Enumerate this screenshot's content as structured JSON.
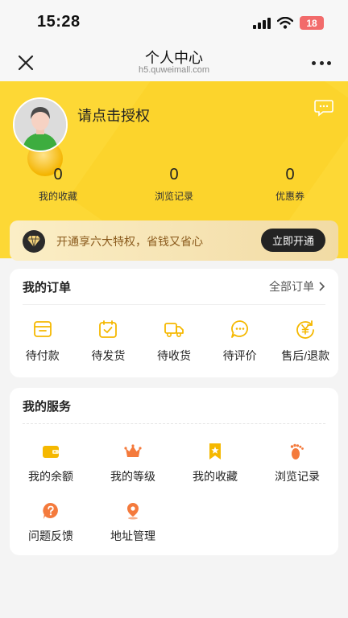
{
  "status_bar": {
    "time": "15:28",
    "battery": "18"
  },
  "nav": {
    "title": "个人中心",
    "subtitle": "h5.quweimall.com"
  },
  "profile": {
    "login_prompt": "请点击授权"
  },
  "stats": [
    {
      "value": "0",
      "label": "我的收藏"
    },
    {
      "value": "0",
      "label": "浏览记录"
    },
    {
      "value": "0",
      "label": "优惠券"
    }
  ],
  "vip": {
    "text": "开通享六大特权，省钱又省心",
    "button": "立即开通"
  },
  "orders": {
    "title": "我的订单",
    "all_label": "全部订单",
    "items": [
      {
        "label": "待付款",
        "icon": "wallet-card-icon"
      },
      {
        "label": "待发货",
        "icon": "package-check-icon"
      },
      {
        "label": "待收货",
        "icon": "truck-icon"
      },
      {
        "label": "待评价",
        "icon": "chat-bubble-icon"
      },
      {
        "label": "售后/退款",
        "icon": "refund-yen-icon"
      }
    ]
  },
  "services": {
    "title": "我的服务",
    "items": [
      {
        "label": "我的余额",
        "icon": "wallet-icon"
      },
      {
        "label": "我的等级",
        "icon": "crown-icon"
      },
      {
        "label": "我的收藏",
        "icon": "bookmark-star-icon"
      },
      {
        "label": "浏览记录",
        "icon": "footprint-icon"
      },
      {
        "label": "问题反馈",
        "icon": "question-icon"
      },
      {
        "label": "地址管理",
        "icon": "location-pin-icon"
      }
    ]
  },
  "colors": {
    "header_yellow": "#fdd835",
    "accent_yellow": "#f5b800",
    "service_orange": "#f47a3c"
  }
}
